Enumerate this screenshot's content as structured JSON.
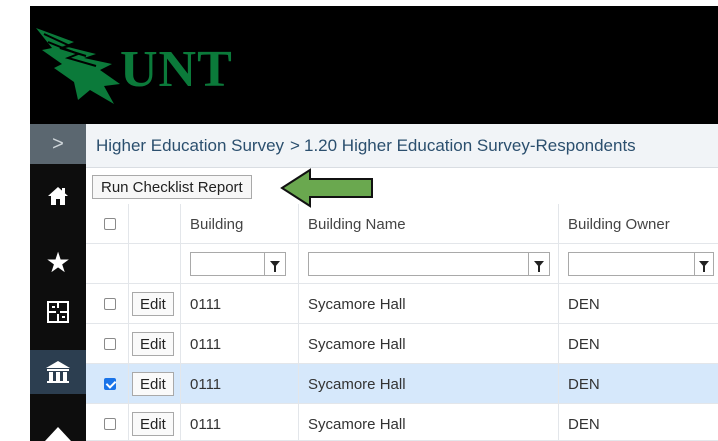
{
  "app": {
    "logo_text": "UNT",
    "logo_icon": "eagle-logo-icon",
    "brand_color": "#0b7a3a"
  },
  "nav": {
    "toggle_icon": "chevron-right-icon",
    "items": [
      {
        "icon": "home-icon",
        "glyph": "⌂"
      },
      {
        "icon": "star-icon",
        "glyph": "★"
      },
      {
        "icon": "floorplan-icon",
        "glyph": "⊞"
      },
      {
        "icon": "building-icon",
        "glyph": "⌂"
      },
      {
        "icon": "campus-icon",
        "glyph": "▲"
      }
    ]
  },
  "breadcrumb": {
    "parent": "Higher Education Survey",
    "separator": ">",
    "current": "1.20 Higher Education Survey-Respondents"
  },
  "toolbar": {
    "run_report_label": "Run Checklist Report"
  },
  "annotation": {
    "arrow_color": "#6aa84f"
  },
  "table": {
    "columns": {
      "building": "Building",
      "building_name": "Building Name",
      "building_owner": "Building Owner"
    },
    "edit_label": "Edit",
    "rows": [
      {
        "checked": false,
        "building": "0111",
        "building_name": "Sycamore Hall",
        "building_owner": "DEN"
      },
      {
        "checked": false,
        "building": "0111",
        "building_name": "Sycamore Hall",
        "building_owner": "DEN"
      },
      {
        "checked": true,
        "building": "0111",
        "building_name": "Sycamore Hall",
        "building_owner": "DEN"
      },
      {
        "checked": false,
        "building": "0111",
        "building_name": "Sycamore Hall",
        "building_owner": "DEN"
      }
    ]
  }
}
